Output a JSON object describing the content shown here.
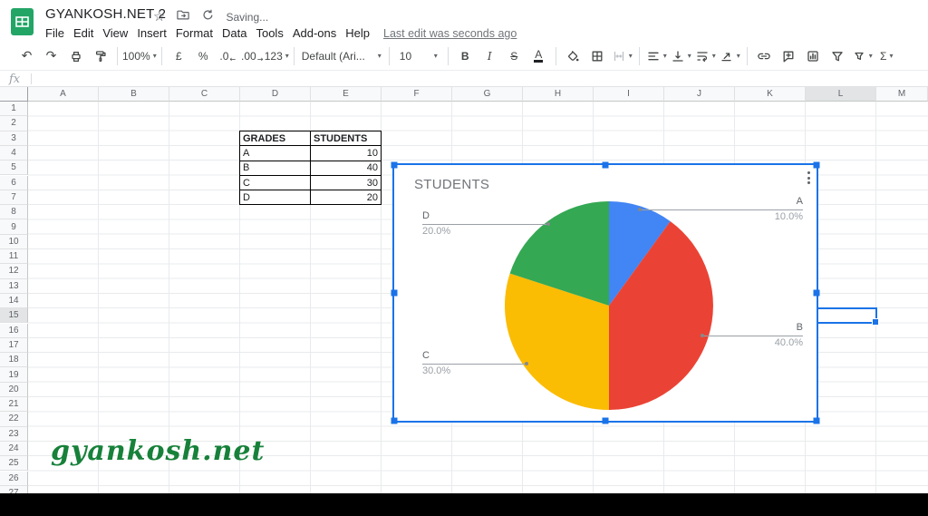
{
  "header": {
    "doc_title": "GYANKOSH.NET 2",
    "saving_status": "Saving...",
    "menu_items": [
      "File",
      "Edit",
      "View",
      "Insert",
      "Format",
      "Data",
      "Tools",
      "Add-ons",
      "Help"
    ],
    "last_edit_label": "Last edit was seconds ago"
  },
  "toolbar": {
    "items": [
      {
        "name": "undo",
        "type": "icon"
      },
      {
        "name": "redo",
        "type": "icon"
      },
      {
        "name": "print",
        "type": "icon"
      },
      {
        "name": "paint-format",
        "type": "icon"
      },
      {
        "type": "divider"
      },
      {
        "name": "zoom",
        "type": "dropdown",
        "label": "100%"
      },
      {
        "type": "divider"
      },
      {
        "name": "format-as-currency",
        "type": "text",
        "label": "£"
      },
      {
        "name": "format-as-percent",
        "type": "text",
        "label": "%"
      },
      {
        "name": "decrease-decimal-places",
        "type": "text",
        "label": ".0"
      },
      {
        "name": "increase-decimal-places",
        "type": "text",
        "label": ".00"
      },
      {
        "name": "more-formats",
        "type": "dropdown",
        "label": "123"
      },
      {
        "type": "divider"
      },
      {
        "name": "font-family",
        "type": "dropdown",
        "label": "Default (Ari..."
      },
      {
        "type": "divider"
      },
      {
        "name": "font-size",
        "type": "dropdown",
        "label": "10"
      },
      {
        "type": "divider"
      },
      {
        "name": "bold",
        "type": "text",
        "label": "B"
      },
      {
        "name": "italic",
        "type": "text",
        "label": "I"
      },
      {
        "name": "strikethrough",
        "type": "text",
        "label": "S"
      },
      {
        "name": "text-color",
        "type": "text",
        "label": "A"
      },
      {
        "type": "divider"
      },
      {
        "name": "fill-color",
        "type": "icon"
      },
      {
        "name": "borders",
        "type": "icon"
      },
      {
        "name": "merge-cells",
        "type": "icon",
        "dropdown": true,
        "disabled": true
      },
      {
        "type": "divider"
      },
      {
        "name": "horizontal-align",
        "type": "icon",
        "dropdown": true
      },
      {
        "name": "vertical-align",
        "type": "icon",
        "dropdown": true
      },
      {
        "name": "text-wrapping",
        "type": "icon",
        "dropdown": true
      },
      {
        "name": "text-rotation",
        "type": "icon",
        "dropdown": true
      },
      {
        "type": "divider"
      },
      {
        "name": "insert-link",
        "type": "icon"
      },
      {
        "name": "insert-comment",
        "type": "icon"
      },
      {
        "name": "insert-chart",
        "type": "icon"
      },
      {
        "name": "create-filter",
        "type": "icon"
      },
      {
        "name": "filter-views",
        "type": "icon",
        "dropdown": true
      },
      {
        "name": "functions",
        "type": "text",
        "label": "Σ",
        "dropdown": true
      }
    ]
  },
  "formula_bar": {
    "fx_label": "fx",
    "value": ""
  },
  "grid": {
    "columns": [
      "A",
      "B",
      "C",
      "D",
      "E",
      "F",
      "G",
      "H",
      "I",
      "J",
      "K",
      "L",
      "M"
    ],
    "row_count": 27,
    "selected_column": "L",
    "selected_row": 15
  },
  "table": {
    "headers": [
      "GRADES",
      "STUDENTS"
    ],
    "rows": [
      [
        "A",
        "10"
      ],
      [
        "B",
        "40"
      ],
      [
        "C",
        "30"
      ],
      [
        "D",
        "20"
      ]
    ]
  },
  "chart_data": {
    "type": "pie",
    "title": "STUDENTS",
    "categories": [
      "A",
      "B",
      "C",
      "D"
    ],
    "values": [
      10,
      40,
      30,
      20
    ],
    "percent_labels": [
      "10.0%",
      "40.0%",
      "30.0%",
      "20.0%"
    ],
    "slice_colors": [
      "#4285F4",
      "#EA4335",
      "#FBBC04",
      "#34A853"
    ],
    "start_angle_deg": 0,
    "clockwise": true,
    "labels": "outside-callout",
    "legend_position": "none"
  },
  "watermark": {
    "text": "gyankosh.net",
    "color": "#17813a"
  }
}
